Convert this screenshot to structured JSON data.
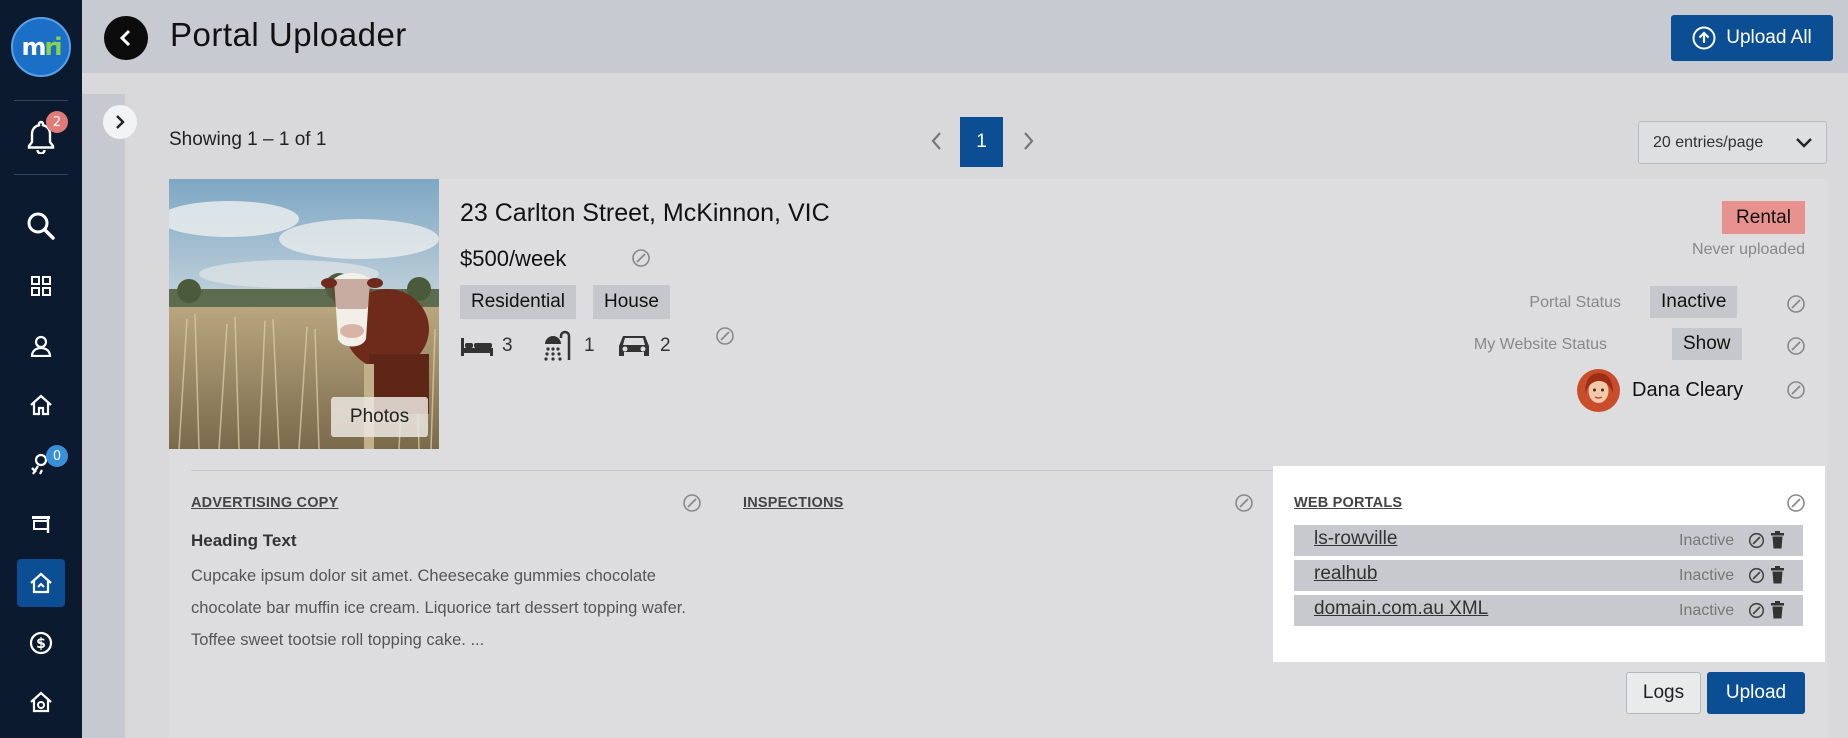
{
  "header": {
    "title": "Portal Uploader",
    "upload_all_label": "Upload All"
  },
  "sidebar": {
    "logo_text_1": "m",
    "logo_text_2": "ri",
    "notifications_count": "2",
    "tasks_count": "0",
    "items": [
      {
        "icon": "search-icon"
      },
      {
        "icon": "dashboard-icon"
      },
      {
        "icon": "contacts-icon"
      },
      {
        "icon": "home-icon"
      },
      {
        "icon": "tasks-icon"
      },
      {
        "icon": "sign-icon"
      },
      {
        "icon": "listings-icon",
        "active": true
      },
      {
        "icon": "dollar-icon"
      },
      {
        "icon": "portal-icon"
      }
    ]
  },
  "pagination": {
    "showing": "Showing 1 – 1 of 1",
    "current_page": "1",
    "entries_per_page": "20 entries/page"
  },
  "listing": {
    "address": "23 Carlton Street, McKinnon, VIC",
    "price": "$500/week",
    "tags": [
      "Residential",
      "House"
    ],
    "bedrooms": "3",
    "bathrooms": "1",
    "car_spaces": "2",
    "photos_label": "Photos",
    "type_badge": "Rental",
    "upload_status": "Never uploaded",
    "portal_status_label": "Portal Status",
    "portal_status_value": "Inactive",
    "website_status_label": "My Website Status",
    "website_status_value": "Show",
    "agent_name": "Dana Cleary"
  },
  "advertising": {
    "title": "ADVERTISING COPY",
    "heading": "Heading Text",
    "body": "Cupcake ipsum dolor sit amet. Cheesecake gummies chocolate chocolate bar muffin ice cream. Liquorice tart dessert topping wafer. Toffee sweet tootsie roll topping cake. ..."
  },
  "inspections": {
    "title": "INSPECTIONS"
  },
  "web_portals": {
    "title": "WEB PORTALS",
    "portals": [
      {
        "name": "ls-rowville",
        "status": "Inactive"
      },
      {
        "name": "realhub",
        "status": "Inactive"
      },
      {
        "name": "domain.com.au XML",
        "status": "Inactive"
      }
    ]
  },
  "actions": {
    "logs_label": "Logs",
    "upload_label": "Upload"
  },
  "colors": {
    "sidebar_bg": "#0b1a2e",
    "accent": "#0c4e93",
    "rental_badge": "#e8928f",
    "notification_badge": "#e07b78",
    "tasks_badge": "#3a8fd9"
  }
}
